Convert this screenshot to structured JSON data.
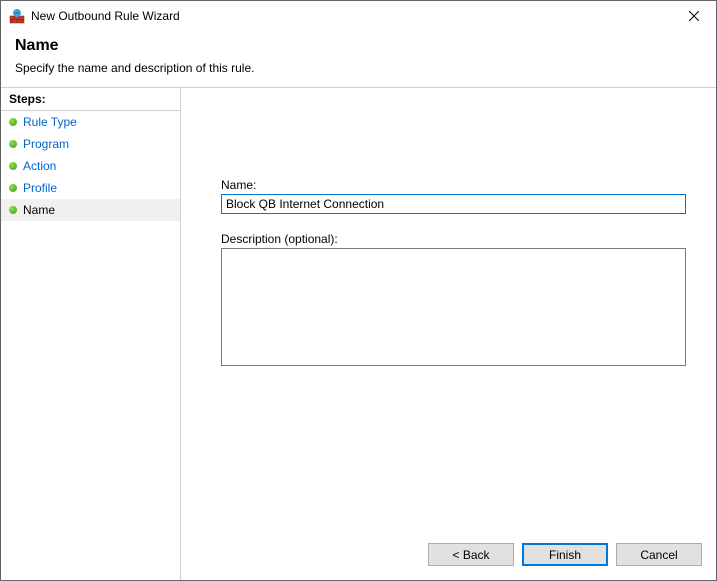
{
  "window": {
    "title": "New Outbound Rule Wizard"
  },
  "header": {
    "heading": "Name",
    "subtitle": "Specify the name and description of this rule."
  },
  "sidebar": {
    "steps_header": "Steps:",
    "items": [
      {
        "label": "Rule Type",
        "current": false
      },
      {
        "label": "Program",
        "current": false
      },
      {
        "label": "Action",
        "current": false
      },
      {
        "label": "Profile",
        "current": false
      },
      {
        "label": "Name",
        "current": true
      }
    ]
  },
  "form": {
    "name_label": "Name:",
    "name_value": "Block QB Internet Connection",
    "desc_label": "Description (optional):",
    "desc_value": ""
  },
  "buttons": {
    "back": "< Back",
    "finish": "Finish",
    "cancel": "Cancel"
  }
}
